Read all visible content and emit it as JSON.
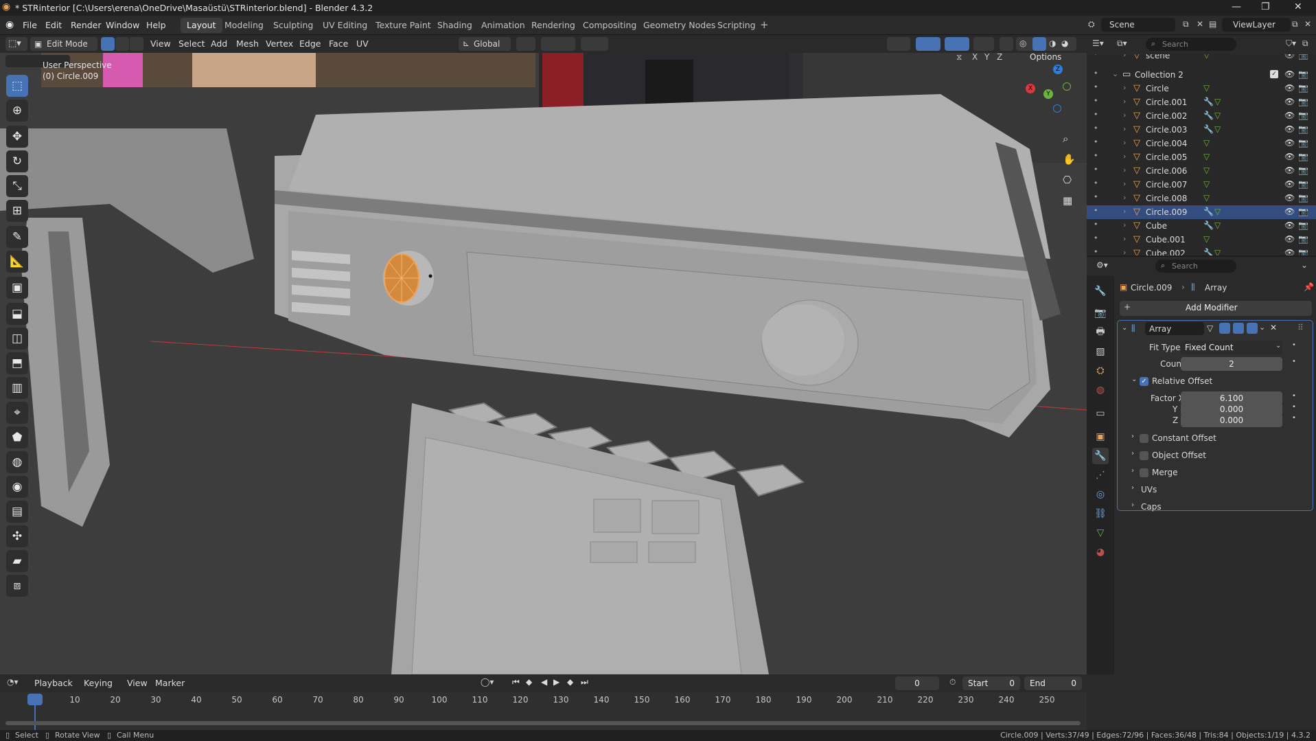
{
  "window": {
    "title": "* STRinterior [C:\\Users\\erena\\OneDrive\\Masaüstü\\STRinterior.blend] - Blender 4.3.2",
    "controls": [
      "minimize-icon",
      "maximize-icon",
      "close-icon"
    ]
  },
  "menu": [
    "File",
    "Edit",
    "Render",
    "Window",
    "Help"
  ],
  "workspaces": [
    "Layout",
    "Modeling",
    "Sculpting",
    "UV Editing",
    "Texture Paint",
    "Shading",
    "Animation",
    "Rendering",
    "Compositing",
    "Geometry Nodes",
    "Scripting"
  ],
  "active_workspace": "Layout",
  "scene": {
    "label": "Scene",
    "viewlayer": "ViewLayer"
  },
  "viewport_header": {
    "mode": "Edit Mode",
    "menus": [
      "View",
      "Select",
      "Add",
      "Mesh",
      "Vertex",
      "Edge",
      "Face",
      "UV"
    ],
    "orientation": "Global",
    "options": "Options",
    "axes": [
      "X",
      "Y",
      "Z"
    ]
  },
  "viewport": {
    "perspective": "User Perspective",
    "object": "(0) Circle.009",
    "gizmo": {
      "x": "X",
      "y": "Y",
      "z": "Z"
    }
  },
  "toolbar": [
    "select-box-tool",
    "cursor-tool",
    "move-tool",
    "rotate-tool",
    "scale-tool",
    "transform-tool",
    "annotate-tool",
    "measure-tool",
    "add-cube-tool",
    "extrude-tool",
    "inset-tool",
    "bevel-tool",
    "loop-cut-tool",
    "knife-tool",
    "poly-build-tool",
    "spin-tool",
    "smooth-tool",
    "edge-slide-tool",
    "shrink-fatten-tool",
    "shear-tool",
    "rip-tool"
  ],
  "outliner": {
    "search_placeholder": "Search",
    "items": [
      {
        "name": "scene",
        "level": 2,
        "type": "object"
      },
      {
        "name": "Collection 2",
        "level": 1,
        "type": "collection"
      },
      {
        "name": "Circle",
        "level": 2,
        "type": "object",
        "modifiers": false
      },
      {
        "name": "Circle.001",
        "level": 2,
        "type": "object",
        "modifiers": true
      },
      {
        "name": "Circle.002",
        "level": 2,
        "type": "object",
        "modifiers": true
      },
      {
        "name": "Circle.003",
        "level": 2,
        "type": "object",
        "modifiers": true
      },
      {
        "name": "Circle.004",
        "level": 2,
        "type": "object",
        "modifiers": false
      },
      {
        "name": "Circle.005",
        "level": 2,
        "type": "object",
        "modifiers": false
      },
      {
        "name": "Circle.006",
        "level": 2,
        "type": "object",
        "modifiers": false
      },
      {
        "name": "Circle.007",
        "level": 2,
        "type": "object",
        "modifiers": false
      },
      {
        "name": "Circle.008",
        "level": 2,
        "type": "object",
        "modifiers": false
      },
      {
        "name": "Circle.009",
        "level": 2,
        "type": "object",
        "modifiers": true,
        "active": true
      },
      {
        "name": "Cube",
        "level": 2,
        "type": "object",
        "modifiers": true
      },
      {
        "name": "Cube.001",
        "level": 2,
        "type": "object",
        "modifiers": false
      },
      {
        "name": "Cube.002",
        "level": 2,
        "type": "object",
        "modifiers": true
      }
    ]
  },
  "properties": {
    "search_placeholder": "Search",
    "breadcrumb": [
      "Circle.009",
      "Array"
    ],
    "add_modifier": "Add Modifier",
    "modifier": {
      "name": "Array",
      "fit_type_label": "Fit Type",
      "fit_type": "Fixed Count",
      "count_label": "Count",
      "count": "2",
      "relative_offset": "Relative Offset",
      "factor_x_label": "Factor X",
      "factor_x": "6.100",
      "y_label": "Y",
      "y": "0.000",
      "z_label": "Z",
      "z": "0.000",
      "subpanels": [
        "Constant Offset",
        "Object Offset",
        "Merge",
        "UVs",
        "Caps"
      ]
    }
  },
  "timeline": {
    "menus": [
      "Playback",
      "Keying",
      "View",
      "Marker"
    ],
    "current_frame": "0",
    "start_label": "Start",
    "start": "0",
    "end_label": "End",
    "end": "0",
    "ticks": [
      "0",
      "10",
      "20",
      "30",
      "40",
      "50",
      "60",
      "70",
      "80",
      "90",
      "100",
      "110",
      "120",
      "130",
      "140",
      "150",
      "160",
      "170",
      "180",
      "190",
      "200",
      "210",
      "220",
      "230",
      "240",
      "250"
    ]
  },
  "statusbar": {
    "left": [
      "Select",
      "Rotate View",
      "Call Menu"
    ],
    "right": "Circle.009 | Verts:37/49 | Edges:72/96 | Faces:36/48 | Tris:84 | Objects:1/19 | 4.3.2"
  },
  "colors": {
    "accent": "#4772b3",
    "selection": "#f0a254",
    "background": "#1d1d1d"
  }
}
